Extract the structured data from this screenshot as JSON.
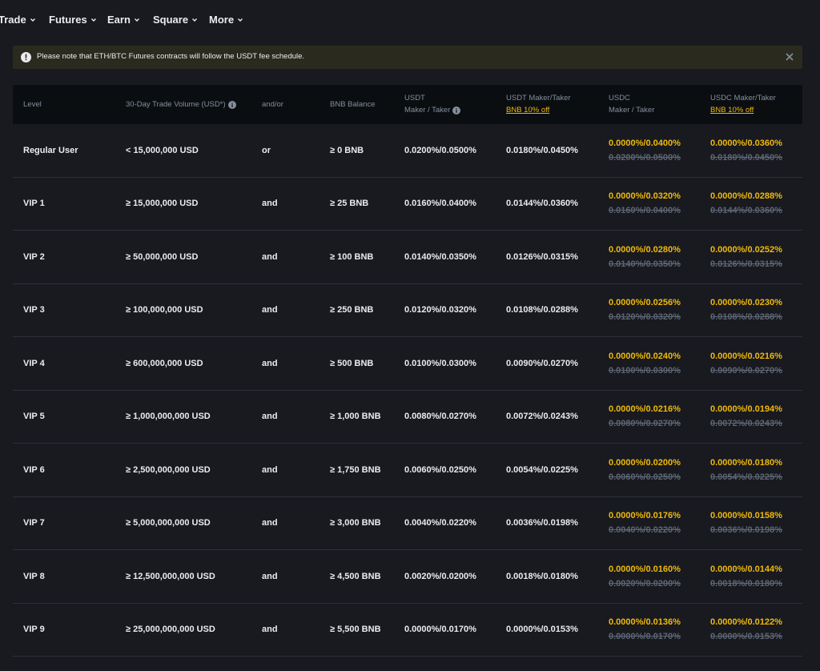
{
  "nav": {
    "items": [
      {
        "label": "Trade"
      },
      {
        "label": "Futures"
      },
      {
        "label": "Earn"
      },
      {
        "label": "Square"
      },
      {
        "label": "More"
      }
    ]
  },
  "notice": {
    "text": "Please note that ETH/BTC Futures contracts will follow the USDT fee schedule."
  },
  "table": {
    "headers": {
      "level": "Level",
      "volume": "30-Day Trade Volume (USD*)",
      "andor": "and/or",
      "bnb": "BNB Balance",
      "usdt_line1": "USDT",
      "usdt_line2": "Maker / Taker",
      "usdt_off_line1": "USDT Maker/Taker",
      "usdt_off_line2": "BNB 10% off",
      "usdc_line1": "USDC",
      "usdc_line2": "Maker / Taker",
      "usdc_off_line1": "USDC Maker/Taker",
      "usdc_off_line2": "BNB 10% off"
    },
    "rows": [
      {
        "level": "Regular User",
        "volume": "< 15,000,000 USD",
        "andor": "or",
        "bnb": "≥ 0 BNB",
        "usdt": "0.0200%/0.0500%",
        "usdt_off": "0.0180%/0.0450%",
        "usdc_new": "0.0000%/0.0400%",
        "usdc_old": "0.0200%/0.0500%",
        "usdc_off_new": "0.0000%/0.0360%",
        "usdc_off_old": "0.0180%/0.0450%"
      },
      {
        "level": "VIP 1",
        "volume": "≥ 15,000,000 USD",
        "andor": "and",
        "bnb": "≥ 25 BNB",
        "usdt": "0.0160%/0.0400%",
        "usdt_off": "0.0144%/0.0360%",
        "usdc_new": "0.0000%/0.0320%",
        "usdc_old": "0.0160%/0.0400%",
        "usdc_off_new": "0.0000%/0.0288%",
        "usdc_off_old": "0.0144%/0.0360%"
      },
      {
        "level": "VIP 2",
        "volume": "≥ 50,000,000 USD",
        "andor": "and",
        "bnb": "≥ 100 BNB",
        "usdt": "0.0140%/0.0350%",
        "usdt_off": "0.0126%/0.0315%",
        "usdc_new": "0.0000%/0.0280%",
        "usdc_old": "0.0140%/0.0350%",
        "usdc_off_new": "0.0000%/0.0252%",
        "usdc_off_old": "0.0126%/0.0315%"
      },
      {
        "level": "VIP 3",
        "volume": "≥ 100,000,000 USD",
        "andor": "and",
        "bnb": "≥ 250 BNB",
        "usdt": "0.0120%/0.0320%",
        "usdt_off": "0.0108%/0.0288%",
        "usdc_new": "0.0000%/0.0256%",
        "usdc_old": "0.0120%/0.0320%",
        "usdc_off_new": "0.0000%/0.0230%",
        "usdc_off_old": "0.0108%/0.0288%"
      },
      {
        "level": "VIP 4",
        "volume": "≥ 600,000,000 USD",
        "andor": "and",
        "bnb": "≥ 500 BNB",
        "usdt": "0.0100%/0.0300%",
        "usdt_off": "0.0090%/0.0270%",
        "usdc_new": "0.0000%/0.0240%",
        "usdc_old": "0.0100%/0.0300%",
        "usdc_off_new": "0.0000%/0.0216%",
        "usdc_off_old": "0.0090%/0.0270%"
      },
      {
        "level": "VIP 5",
        "volume": "≥ 1,000,000,000 USD",
        "andor": "and",
        "bnb": "≥ 1,000 BNB",
        "usdt": "0.0080%/0.0270%",
        "usdt_off": "0.0072%/0.0243%",
        "usdc_new": "0.0000%/0.0216%",
        "usdc_old": "0.0080%/0.0270%",
        "usdc_off_new": "0.0000%/0.0194%",
        "usdc_off_old": "0.0072%/0.0243%"
      },
      {
        "level": "VIP 6",
        "volume": "≥ 2,500,000,000 USD",
        "andor": "and",
        "bnb": "≥ 1,750 BNB",
        "usdt": "0.0060%/0.0250%",
        "usdt_off": "0.0054%/0.0225%",
        "usdc_new": "0.0000%/0.0200%",
        "usdc_old": "0.0060%/0.0250%",
        "usdc_off_new": "0.0000%/0.0180%",
        "usdc_off_old": "0.0054%/0.0225%"
      },
      {
        "level": "VIP 7",
        "volume": "≥ 5,000,000,000 USD",
        "andor": "and",
        "bnb": "≥ 3,000 BNB",
        "usdt": "0.0040%/0.0220%",
        "usdt_off": "0.0036%/0.0198%",
        "usdc_new": "0.0000%/0.0176%",
        "usdc_old": "0.0040%/0.0220%",
        "usdc_off_new": "0.0000%/0.0158%",
        "usdc_off_old": "0.0036%/0.0198%"
      },
      {
        "level": "VIP 8",
        "volume": "≥ 12,500,000,000 USD",
        "andor": "and",
        "bnb": "≥ 4,500 BNB",
        "usdt": "0.0020%/0.0200%",
        "usdt_off": "0.0018%/0.0180%",
        "usdc_new": "0.0000%/0.0160%",
        "usdc_old": "0.0020%/0.0200%",
        "usdc_off_new": "0.0000%/0.0144%",
        "usdc_off_old": "0.0018%/0.0180%"
      },
      {
        "level": "VIP 9",
        "volume": "≥ 25,000,000,000 USD",
        "andor": "and",
        "bnb": "≥ 5,500 BNB",
        "usdt": "0.0000%/0.0170%",
        "usdt_off": "0.0000%/0.0153%",
        "usdc_new": "0.0000%/0.0136%",
        "usdc_old": "0.0000%/0.0170%",
        "usdc_off_new": "0.0000%/0.0122%",
        "usdc_off_old": "0.0000%/0.0153%"
      }
    ]
  },
  "colors": {
    "background": "#181a20",
    "header_bg": "#0b0e11",
    "accent": "#f0b90b",
    "muted": "#848e9c",
    "strike": "#5e6673"
  }
}
